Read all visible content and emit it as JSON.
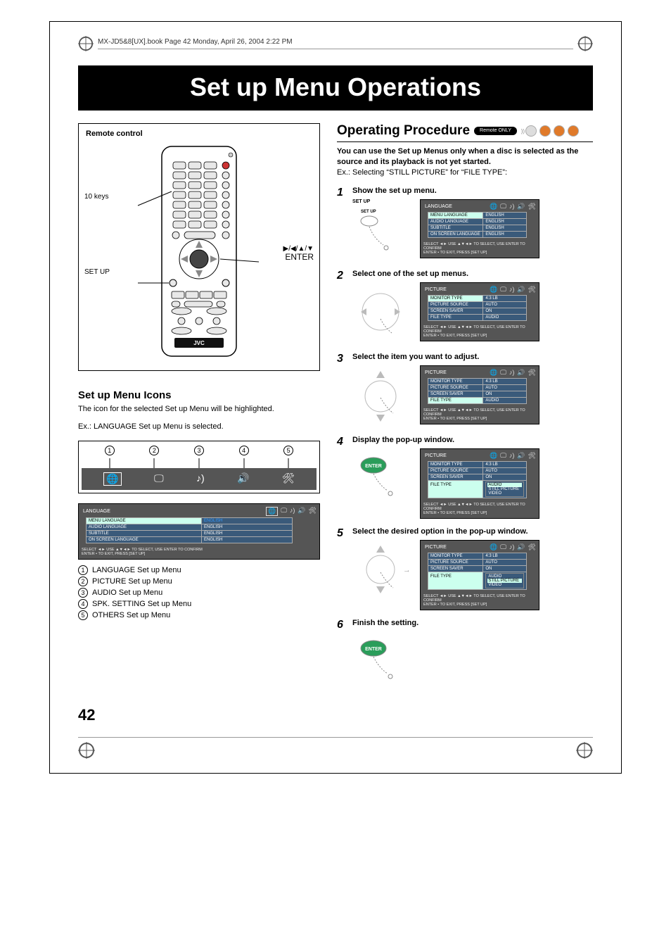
{
  "header": {
    "text": "MX-JD5&8[UX].book  Page 42  Monday, April 26, 2004  2:22 PM"
  },
  "title": "Set up Menu Operations",
  "left": {
    "remote_box_title": "Remote control",
    "label_10keys": "10 keys",
    "label_setup": "SET UP",
    "label_arrows": "▶/◀/▲/▼",
    "label_enter": "ENTER",
    "brand": "JVC",
    "icons_heading": "Set up Menu Icons",
    "icons_text": "The icon for the selected Set up Menu will be highlighted.",
    "icons_example": "Ex.: LANGUAGE Set up Menu is selected.",
    "icon_numbers": [
      "1",
      "2",
      "3",
      "4",
      "5"
    ],
    "osd_language": {
      "panel_label": "LANGUAGE",
      "rows": [
        {
          "k": "MENU LANGUAGE",
          "v": "ENGLISH",
          "sel": true
        },
        {
          "k": "AUDIO LANGUAGE",
          "v": "ENGLISH"
        },
        {
          "k": "SUBTITLE",
          "v": "ENGLISH"
        },
        {
          "k": "ON SCREEN LANGUAGE",
          "v": "ENGLISH"
        }
      ],
      "footer1": "SELECT ◄►  USE ▲▼◄► TO SELECT, USE ENTER TO CONFIRM",
      "footer2": "ENTER •  TO EXIT, PRESS [SET UP]"
    },
    "legend_items": [
      "LANGUAGE Set up Menu",
      "PICTURE Set up Menu",
      "AUDIO Set up Menu",
      "SPK. SETTING Set up Menu",
      "OTHERS Set up Menu"
    ]
  },
  "right": {
    "op_title": "Operating Procedure",
    "badge": "Remote ONLY",
    "intro_bold": "You can use the Set up Menus only when a disc is selected as the source and its playback is not yet started.",
    "intro_ex": "Ex.: Selecting “STILL PICTURE” for “FILE TYPE”:",
    "steps": [
      {
        "num": "1",
        "title": "Show the set up menu.",
        "setup_label": "SET UP",
        "osd": "language"
      },
      {
        "num": "2",
        "title": "Select one of the set up menus.",
        "osd": "picture_sel_monitor"
      },
      {
        "num": "3",
        "title": "Select the item you want to adjust.",
        "osd": "picture_sel_file"
      },
      {
        "num": "4",
        "title": "Display the pop-up window.",
        "osd": "picture_popup_audio",
        "enter": true
      },
      {
        "num": "5",
        "title": "Select the desired option in the pop-up window.",
        "osd": "picture_popup_still"
      },
      {
        "num": "6",
        "title": "Finish the setting.",
        "enter": true
      }
    ],
    "osd_screens": {
      "language": {
        "panel_label": "LANGUAGE",
        "rows": [
          {
            "k": "MENU LANGUAGE",
            "v": "ENGLISH",
            "sel": true
          },
          {
            "k": "AUDIO LANGUAGE",
            "v": "ENGLISH"
          },
          {
            "k": "SUBTITLE",
            "v": "ENGLISH"
          },
          {
            "k": "ON SCREEN LANGUAGE",
            "v": "ENGLISH"
          }
        ]
      },
      "picture_sel_monitor": {
        "panel_label": "PICTURE",
        "rows": [
          {
            "k": "MONITOR TYPE",
            "v": "4:3 LB",
            "sel": true
          },
          {
            "k": "PICTURE SOURCE",
            "v": "AUTO"
          },
          {
            "k": "SCREEN SAVER",
            "v": "ON"
          },
          {
            "k": "FILE TYPE",
            "v": "AUDIO"
          }
        ]
      },
      "picture_sel_file": {
        "panel_label": "PICTURE",
        "rows": [
          {
            "k": "MONITOR TYPE",
            "v": "4:3 LB"
          },
          {
            "k": "PICTURE SOURCE",
            "v": "AUTO"
          },
          {
            "k": "SCREEN SAVER",
            "v": "ON"
          },
          {
            "k": "FILE TYPE",
            "v": "AUDIO",
            "sel": true
          }
        ]
      },
      "picture_popup_audio": {
        "panel_label": "PICTURE",
        "rows": [
          {
            "k": "MONITOR TYPE",
            "v": "4:3 LB"
          },
          {
            "k": "PICTURE SOURCE",
            "v": "AUTO"
          },
          {
            "k": "SCREEN SAVER",
            "v": "ON"
          },
          {
            "k": "FILE TYPE",
            "v": "",
            "sel": true
          }
        ],
        "popup": {
          "options": [
            "AUDIO",
            "STILL PICTURE",
            "VIDEO"
          ],
          "sel": 0
        }
      },
      "picture_popup_still": {
        "panel_label": "PICTURE",
        "rows": [
          {
            "k": "MONITOR TYPE",
            "v": "4:3 LB"
          },
          {
            "k": "PICTURE SOURCE",
            "v": "AUTO"
          },
          {
            "k": "SCREEN SAVER",
            "v": "ON"
          },
          {
            "k": "FILE TYPE",
            "v": "",
            "sel": true
          }
        ],
        "popup": {
          "options": [
            "AUDIO",
            "STILL PICTURE",
            "VIDEO"
          ],
          "sel": 1
        }
      }
    },
    "osd_footer1": "SELECT ◄►  USE ▲▼◄► TO SELECT, USE ENTER TO CONFIRM",
    "osd_footer2": "ENTER •  TO EXIT, PRESS [SET UP]",
    "enter_label": "ENTER"
  },
  "page_number": "42"
}
